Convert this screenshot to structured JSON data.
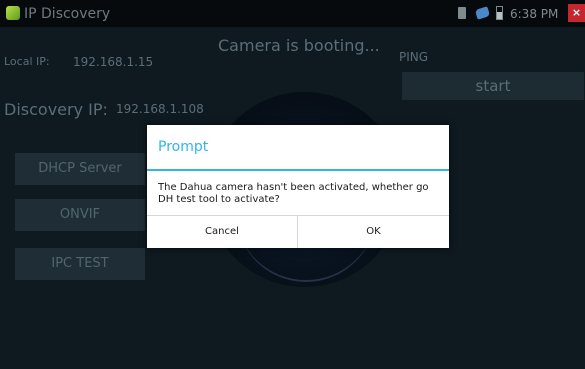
{
  "status_bar": {
    "app_title": "IP Discovery",
    "time": "6:38 PM",
    "close_glyph": "×"
  },
  "main": {
    "booting_text": "Camera is booting...",
    "ping_label": "PING",
    "start_label": "start",
    "local_ip_label": "Local IP:",
    "local_ip_value": "192.168.1.15",
    "discovery_ip_label": "Discovery IP:",
    "discovery_ip_value": "192.168.1.108",
    "dhcp_label": "DHCP Server",
    "onvif_label": "ONVIF",
    "ipc_test_label": "IPC TEST"
  },
  "dialog": {
    "title": "Prompt",
    "message": "The Dahua camera hasn't been activated, whether go DH test tool to activate?",
    "cancel_label": "Cancel",
    "ok_label": "OK"
  },
  "colors": {
    "accent": "#33b5e5",
    "background": "#0e1920",
    "close_red": "#c6262e"
  },
  "icons": {
    "app": "app-icon",
    "sd": "sd-card-icon",
    "usb": "usb-icon",
    "battery": "battery-icon",
    "close": "close-icon"
  }
}
